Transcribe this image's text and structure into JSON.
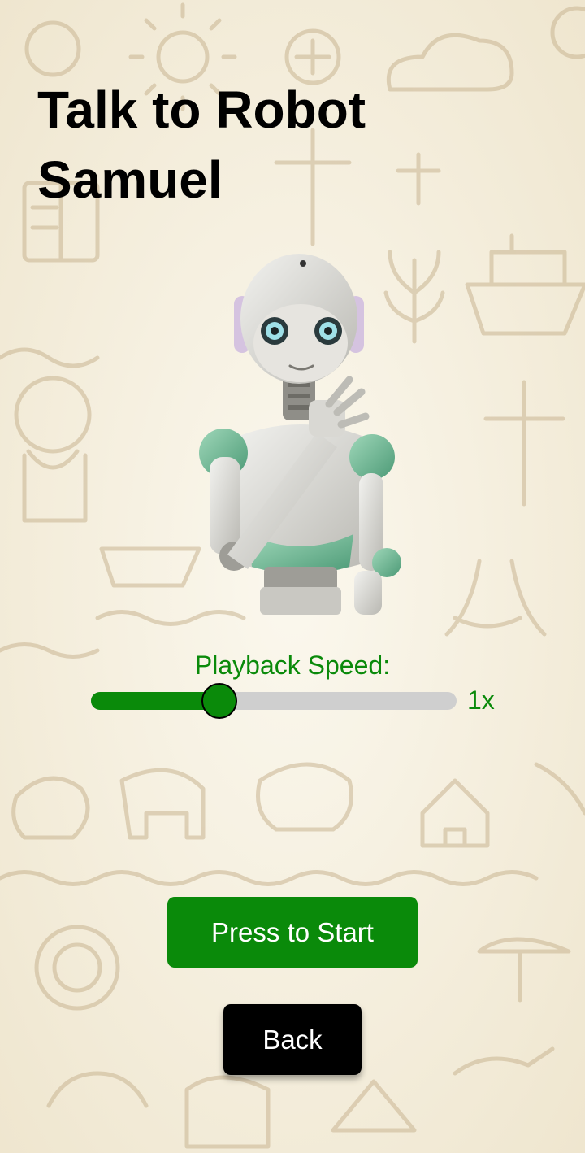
{
  "header": {
    "title": "Talk to Robot\nSamuel"
  },
  "robot": {
    "icon": "robot-avatar"
  },
  "playback": {
    "label": "Playback Speed:",
    "value_label": "1x",
    "level": 0.35
  },
  "buttons": {
    "start_label": "Press to Start",
    "back_label": "Back"
  },
  "colors": {
    "accent": "#0a8a0a",
    "track": "#cfcfcf",
    "background": "#f7f3e6",
    "doodle": "#c9b592"
  }
}
